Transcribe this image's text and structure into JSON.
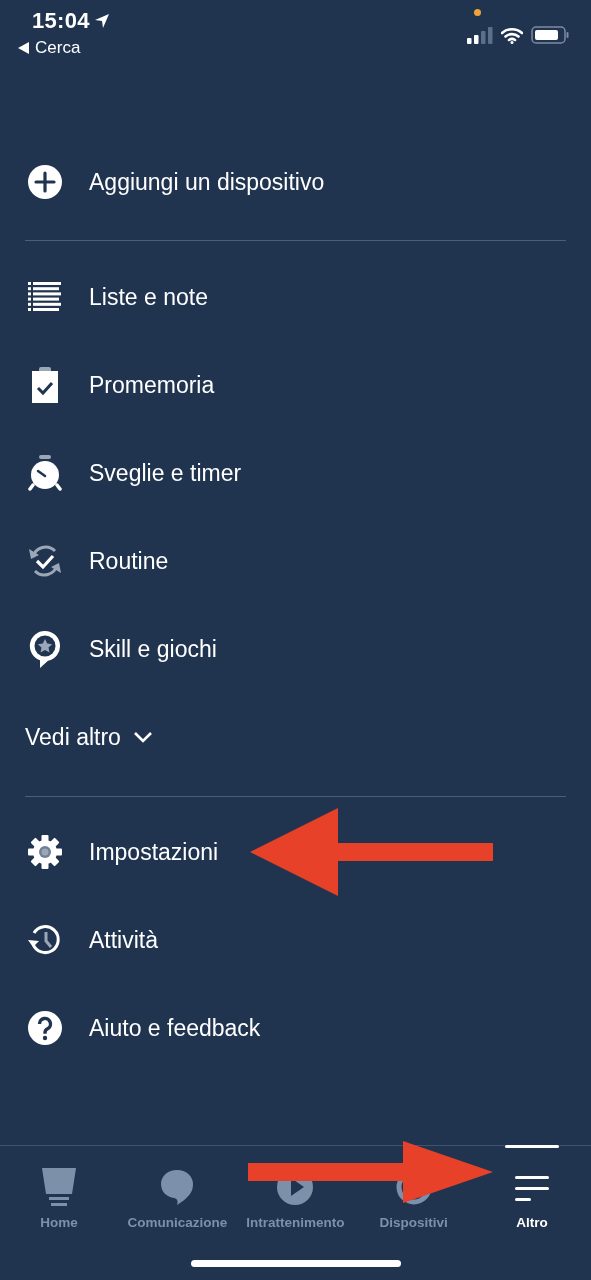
{
  "status_bar": {
    "time": "15:04",
    "back_label": "Cerca"
  },
  "menu_sections": [
    {
      "items": [
        {
          "label": "Aggiungi un dispositivo"
        }
      ]
    },
    {
      "items": [
        {
          "label": "Liste e note"
        },
        {
          "label": "Promemoria"
        },
        {
          "label": "Sveglie e timer"
        },
        {
          "label": "Routine"
        },
        {
          "label": "Skill e giochi"
        }
      ],
      "more": {
        "label": "Vedi altro",
        "expanded": false
      }
    },
    {
      "items": [
        {
          "label": "Impostazioni"
        },
        {
          "label": "Attività"
        },
        {
          "label": "Aiuto e feedback"
        }
      ]
    }
  ],
  "tabs": [
    {
      "label": "Home",
      "selected": false
    },
    {
      "label": "Comunicazione",
      "selected": false
    },
    {
      "label": "Intrattenimento",
      "selected": false
    },
    {
      "label": "Dispositivi",
      "selected": false
    },
    {
      "label": "Altro",
      "selected": true
    }
  ]
}
